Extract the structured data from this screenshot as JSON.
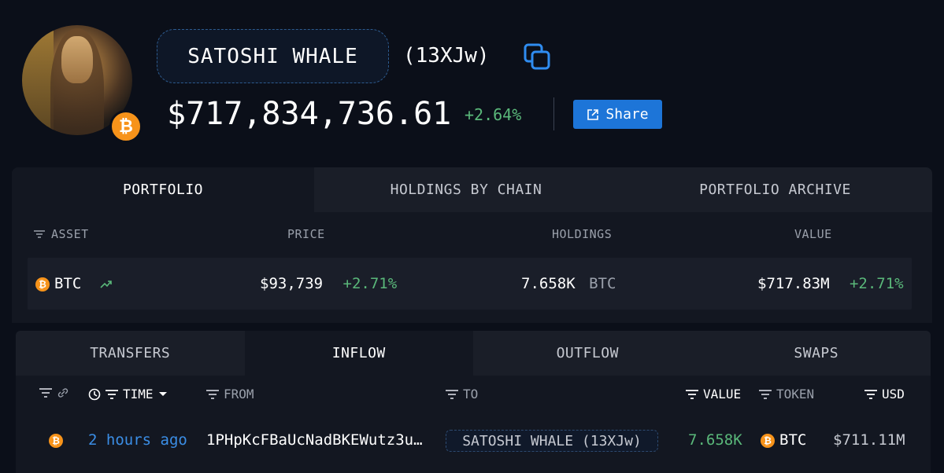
{
  "profile": {
    "entity_name": "SATOSHI WHALE",
    "short_id": "(13XJw)",
    "balance": "$717,834,736.61",
    "balance_change": "+2.64%",
    "share_label": "Share",
    "badge_icon": "bitcoin-icon",
    "accent_color": "#1d75d8",
    "positive_color": "#5ab87a",
    "bitcoin_color": "#f7931a"
  },
  "portfolio": {
    "tabs": [
      {
        "label": "PORTFOLIO",
        "active": true
      },
      {
        "label": "HOLDINGS BY CHAIN",
        "active": false
      },
      {
        "label": "PORTFOLIO ARCHIVE",
        "active": false
      }
    ],
    "columns": {
      "asset": "ASSET",
      "price": "PRICE",
      "holdings": "HOLDINGS",
      "value": "VALUE"
    },
    "rows": [
      {
        "asset": "BTC",
        "price": "$93,739",
        "price_change": "+2.71%",
        "holdings": "7.658K",
        "holdings_unit": "BTC",
        "value": "$717.83M",
        "value_change": "+2.71%"
      }
    ]
  },
  "transfers": {
    "tabs": [
      {
        "label": "TRANSFERS",
        "active": false
      },
      {
        "label": "INFLOW",
        "active": true
      },
      {
        "label": "OUTFLOW",
        "active": false
      },
      {
        "label": "SWAPS",
        "active": false
      }
    ],
    "columns": {
      "time": "TIME",
      "from": "FROM",
      "to": "TO",
      "value": "VALUE",
      "token": "TOKEN",
      "usd": "USD"
    },
    "rows": [
      {
        "time": "2 hours ago",
        "from": "1PHpKcFBaUcNadBKEWutz3u…",
        "to": "SATOSHI WHALE (13XJw)",
        "value": "7.658K",
        "token": "BTC",
        "usd": "$711.11M"
      }
    ]
  }
}
